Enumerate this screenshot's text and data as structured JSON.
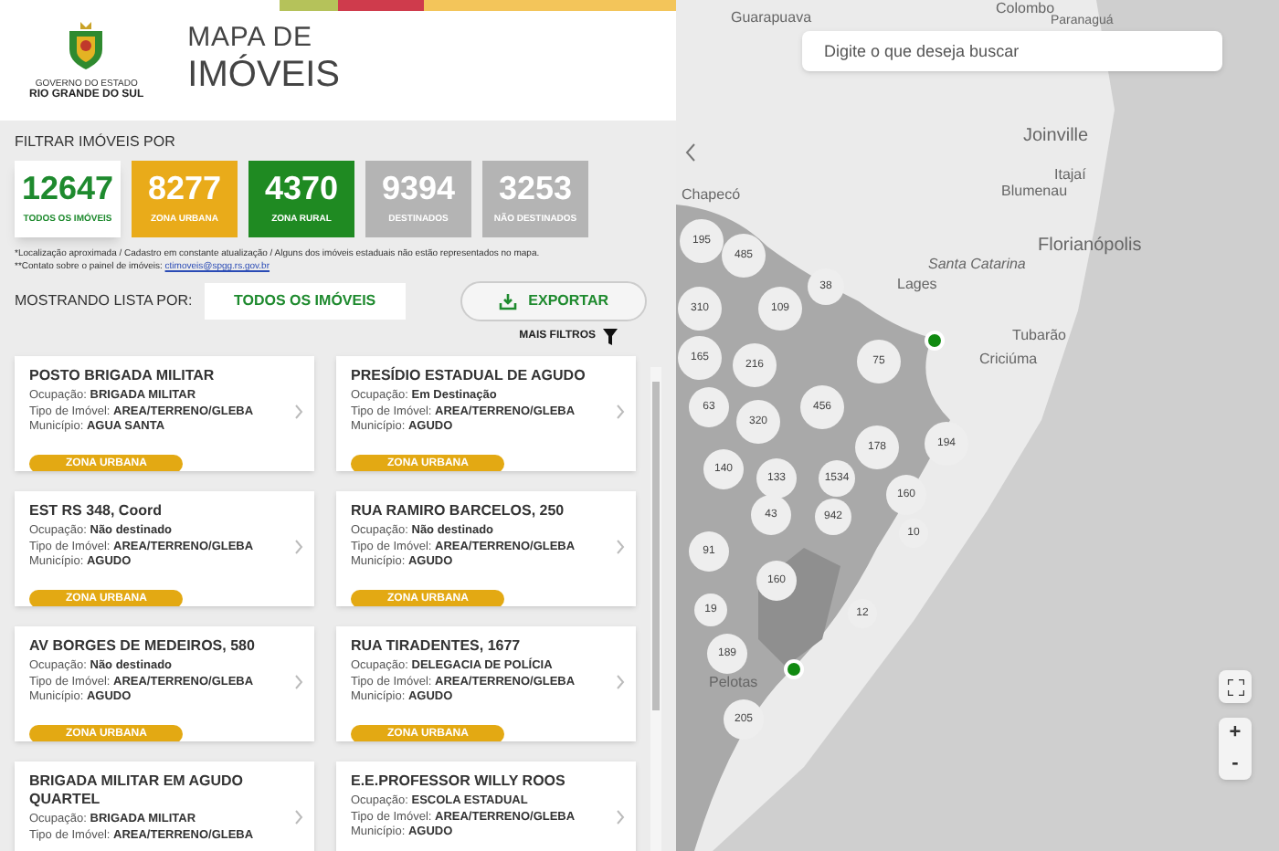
{
  "header": {
    "logo_line1": "GOVERNO DO ESTADO",
    "logo_line2": "RIO GRANDE DO SUL",
    "title_line1": "MAPA DE",
    "title_line2": "IMÓVEIS"
  },
  "filter": {
    "label": "FILTRAR IMÓVEIS POR",
    "stats": [
      {
        "value": "12647",
        "label": "TODOS OS IMÓVEIS",
        "kind": "all",
        "selected": true
      },
      {
        "value": "8277",
        "label": "ZONA URBANA",
        "kind": "urban",
        "selected": false
      },
      {
        "value": "4370",
        "label": "ZONA RURAL",
        "kind": "rural",
        "selected": false
      },
      {
        "value": "9394",
        "label": "DESTINADOS",
        "kind": "neutral",
        "selected": false
      },
      {
        "value": "3253",
        "label": "NÃO DESTINADOS",
        "kind": "neutral",
        "selected": false
      }
    ],
    "note1": "*Localização aproximada / Cadastro em constante atualização / Alguns dos imóveis estaduais não estão representados no mapa.",
    "note2_prefix": "**Contato sobre o painel de imóveis: ",
    "note2_link": "ctimoveis@spgg.rs.gov.br"
  },
  "list_bar": {
    "label": "MOSTRANDO LISTA POR:",
    "value": "TODOS OS IMÓVEIS",
    "export": "EXPORTAR",
    "more_filters": "MAIS FILTROS"
  },
  "cards": [
    {
      "title": "POSTO BRIGADA MILITAR",
      "lines": [
        [
          "Ocupação: ",
          "BRIGADA MILITAR"
        ],
        [
          "Tipo de Imóvel: ",
          "AREA/TERRENO/GLEBA"
        ],
        [
          "Município: ",
          "AGUA SANTA"
        ]
      ],
      "zone": "ZONA URBANA"
    },
    {
      "title": "PRESÍDIO ESTADUAL DE AGUDO",
      "lines": [
        [
          "Ocupação: ",
          "Em Destinação"
        ],
        [
          "Tipo de Imóvel: ",
          "AREA/TERRENO/GLEBA"
        ],
        [
          "Município: ",
          "AGUDO"
        ]
      ],
      "zone": "ZONA URBANA"
    },
    {
      "title": "EST RS 348, Coord",
      "lines": [
        [
          "Ocupação: ",
          "Não destinado"
        ],
        [
          "Tipo de Imóvel: ",
          "AREA/TERRENO/GLEBA"
        ],
        [
          "Município: ",
          "AGUDO"
        ]
      ],
      "zone": "ZONA URBANA"
    },
    {
      "title": "RUA RAMIRO BARCELOS, 250",
      "lines": [
        [
          "Ocupação: ",
          "Não destinado"
        ],
        [
          "Tipo de Imóvel: ",
          "AREA/TERRENO/GLEBA"
        ],
        [
          "Município: ",
          "AGUDO"
        ]
      ],
      "zone": "ZONA URBANA"
    },
    {
      "title": "AV BORGES DE MEDEIROS, 580",
      "lines": [
        [
          "Ocupação: ",
          "Não destinado"
        ],
        [
          "Tipo de Imóvel: ",
          "AREA/TERRENO/GLEBA"
        ],
        [
          "Município: ",
          "AGUDO"
        ]
      ],
      "zone": "ZONA URBANA"
    },
    {
      "title": "RUA TIRADENTES, 1677",
      "lines": [
        [
          "Ocupação: ",
          "DELEGACIA DE POLÍCIA"
        ],
        [
          "Tipo de Imóvel: ",
          "AREA/TERRENO/GLEBA"
        ],
        [
          "Município: ",
          "AGUDO"
        ]
      ],
      "zone": "ZONA URBANA"
    },
    {
      "title": "BRIGADA MILITAR EM AGUDO QUARTEL",
      "lines": [
        [
          "Ocupação: ",
          "BRIGADA MILITAR"
        ],
        [
          "Tipo de Imóvel: ",
          "AREA/TERRENO/GLEBA"
        ]
      ]
    },
    {
      "title": "E.E.PROFESSOR WILLY ROOS",
      "lines": [
        [
          "Ocupação: ",
          "ESCOLA ESTADUAL"
        ],
        [
          "Tipo de Imóvel: ",
          "AREA/TERRENO/GLEBA"
        ],
        [
          "Município: ",
          "AGUDO"
        ]
      ]
    }
  ],
  "map": {
    "search_placeholder": "Digite o que deseja buscar",
    "places": [
      "Guarapuava",
      "Colombo",
      "Paranaguá",
      "Joinville",
      "Itajaí",
      "Blumenau",
      "Florianópolis",
      "Santa Catarina",
      "Lages",
      "Tubarão",
      "Criciúma",
      "Chapecó",
      "Pelotas"
    ],
    "clusters": [
      "195",
      "485",
      "38",
      "310",
      "109",
      "165",
      "216",
      "75",
      "63",
      "320",
      "456",
      "178",
      "194",
      "140",
      "133",
      "1534",
      "942",
      "160",
      "43",
      "10",
      "91",
      "160",
      "19",
      "12",
      "189",
      "205"
    ],
    "zoom_in": "+",
    "zoom_out": "-"
  }
}
